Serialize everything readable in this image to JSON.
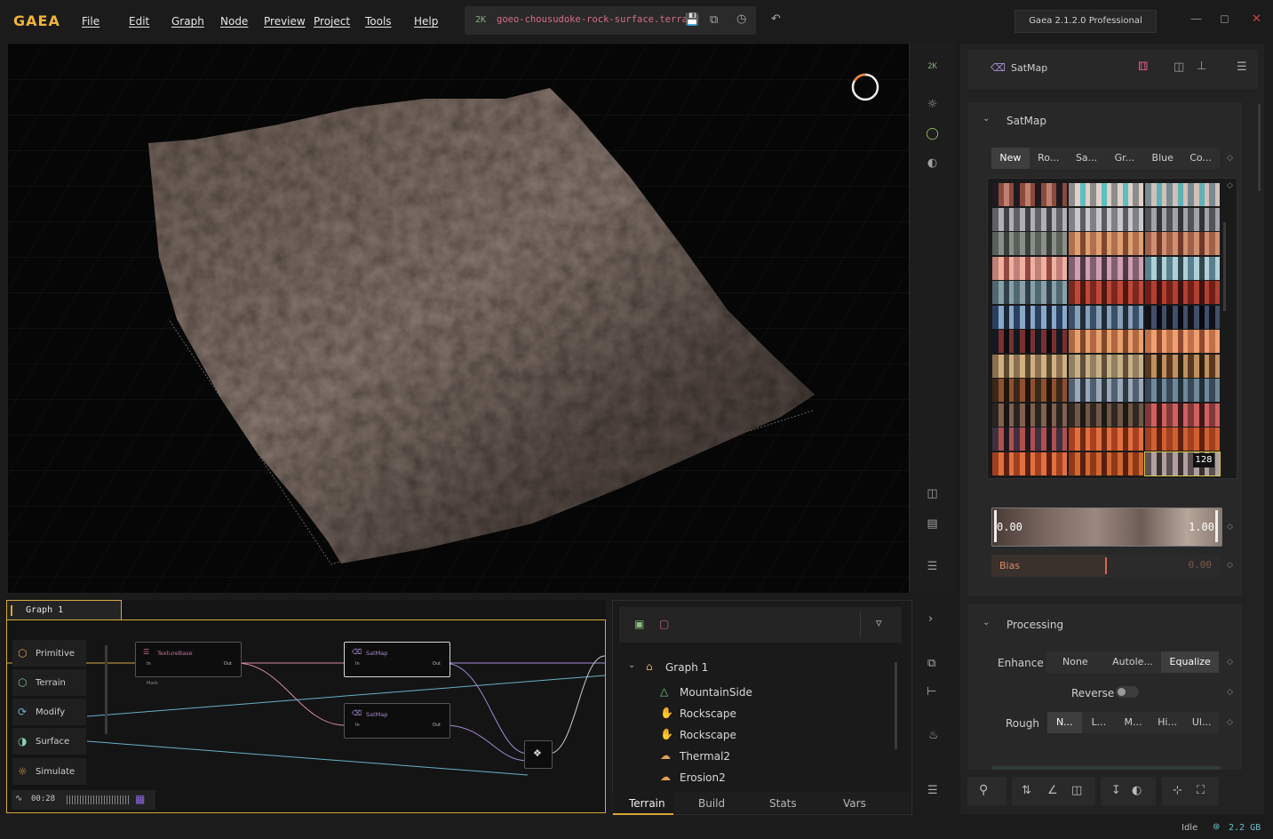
{
  "app": {
    "logo": "GAEA",
    "version": "Gaea 2.1.2.0 Professional"
  },
  "menu": [
    "File",
    "Edit",
    "Graph",
    "Node",
    "Preview",
    "Project",
    "Tools",
    "Help"
  ],
  "file": {
    "resolution": "2K",
    "name": "goeo-chousudoke-rock-surface.terrain"
  },
  "viewport": {
    "resolution_badge": "2K"
  },
  "inspector": {
    "node_title": "SatMap",
    "section_title": "SatMap",
    "tabs": [
      "New",
      "Ro...",
      "Sa...",
      "Gr...",
      "Blue",
      "Co..."
    ],
    "active_tab": "New",
    "swatch_badge": "128",
    "range": {
      "min": "0.00",
      "max": "1.00"
    },
    "bias": {
      "label": "Bias",
      "value": "0.00",
      "fill": 0.5
    },
    "processing": {
      "title": "Processing",
      "enhance_label": "Enhance",
      "enhance_options": [
        "None",
        "Autole...",
        "Equalize"
      ],
      "enhance_active": "Equalize",
      "reverse_label": "Reverse",
      "rough_label": "Rough",
      "rough_options": [
        "N...",
        "L...",
        "M...",
        "Hi...",
        "Ul..."
      ],
      "rough_active": "N..."
    }
  },
  "graph": {
    "tab": "Graph 1",
    "categories": [
      "Primitive",
      "Terrain",
      "Modify",
      "Surface",
      "Simulate"
    ],
    "nodes": [
      {
        "title": "TextureBase",
        "in": "In",
        "out": "Out",
        "extra": "Mask"
      },
      {
        "title": "SatMap",
        "in": "In",
        "out": "Out"
      },
      {
        "title": "SatMap",
        "in": "In",
        "out": "Out"
      }
    ],
    "timer": "00:28"
  },
  "tree": {
    "root": "Graph 1",
    "items": [
      "MountainSide",
      "Rockscape",
      "Rockscape",
      "Thermal2",
      "Erosion2"
    ],
    "tabs": [
      "Terrain",
      "Build",
      "Stats",
      "Vars"
    ],
    "active_tab": "Terrain"
  },
  "status": {
    "state": "Idle",
    "memory": "2.2 GB"
  },
  "colors": {
    "accent": "#f0b43a",
    "filename": "#d86d83",
    "graph_border": "#d7a93a"
  }
}
